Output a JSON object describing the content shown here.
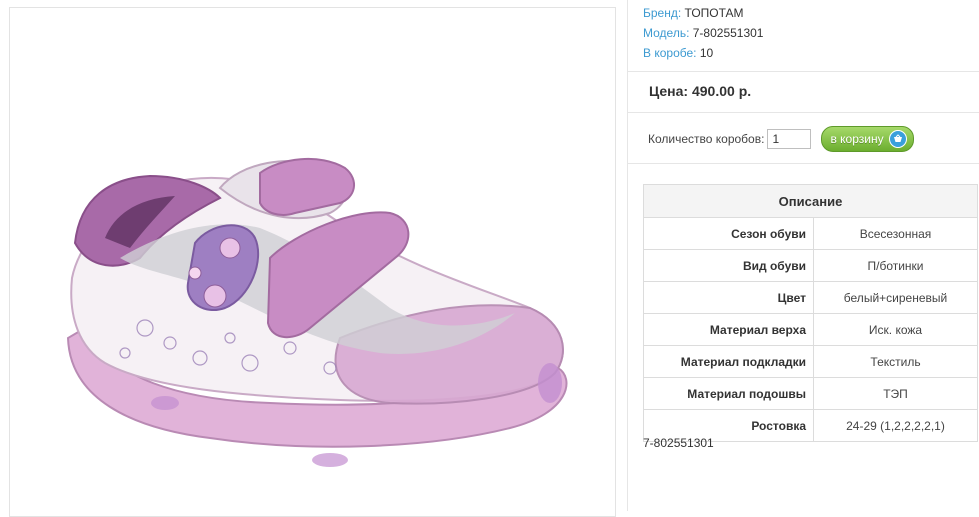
{
  "product": {
    "image_alt": "Pink and white children's sneaker with two velcro straps and flower decorations",
    "brand_label": "Бренд:",
    "brand_value": "ТОПОТАМ",
    "model_label": "Модель:",
    "model_value": "7-802551301",
    "box_label": "В коробе:",
    "box_value": "10",
    "price": "Цена: 490.00 р.",
    "qty_label": "Количество коробов:",
    "qty_value": "1",
    "cart_button": "в корзину",
    "model_code": "7-802551301"
  },
  "description": {
    "title": "Описание",
    "rows": [
      {
        "key": "Сезон обуви",
        "value": "Всесезонная"
      },
      {
        "key": "Вид обуви",
        "value": "П/ботинки"
      },
      {
        "key": "Цвет",
        "value": "белый+сиреневый"
      },
      {
        "key": "Материал верха",
        "value": "Иск. кожа"
      },
      {
        "key": "Материал подкладки",
        "value": "Текстиль"
      },
      {
        "key": "Материал подошвы",
        "value": "ТЭП"
      },
      {
        "key": "Ростовка",
        "value": "24-29 (1,2,2,2,2,1)"
      }
    ]
  },
  "colors": {
    "label_blue": "#3d9ad1",
    "button_green": "#6cae2f",
    "shoe_lilac": "#c993c8",
    "shoe_sole": "#d9a6cf"
  },
  "icons": {
    "cart": "cart-icon"
  }
}
